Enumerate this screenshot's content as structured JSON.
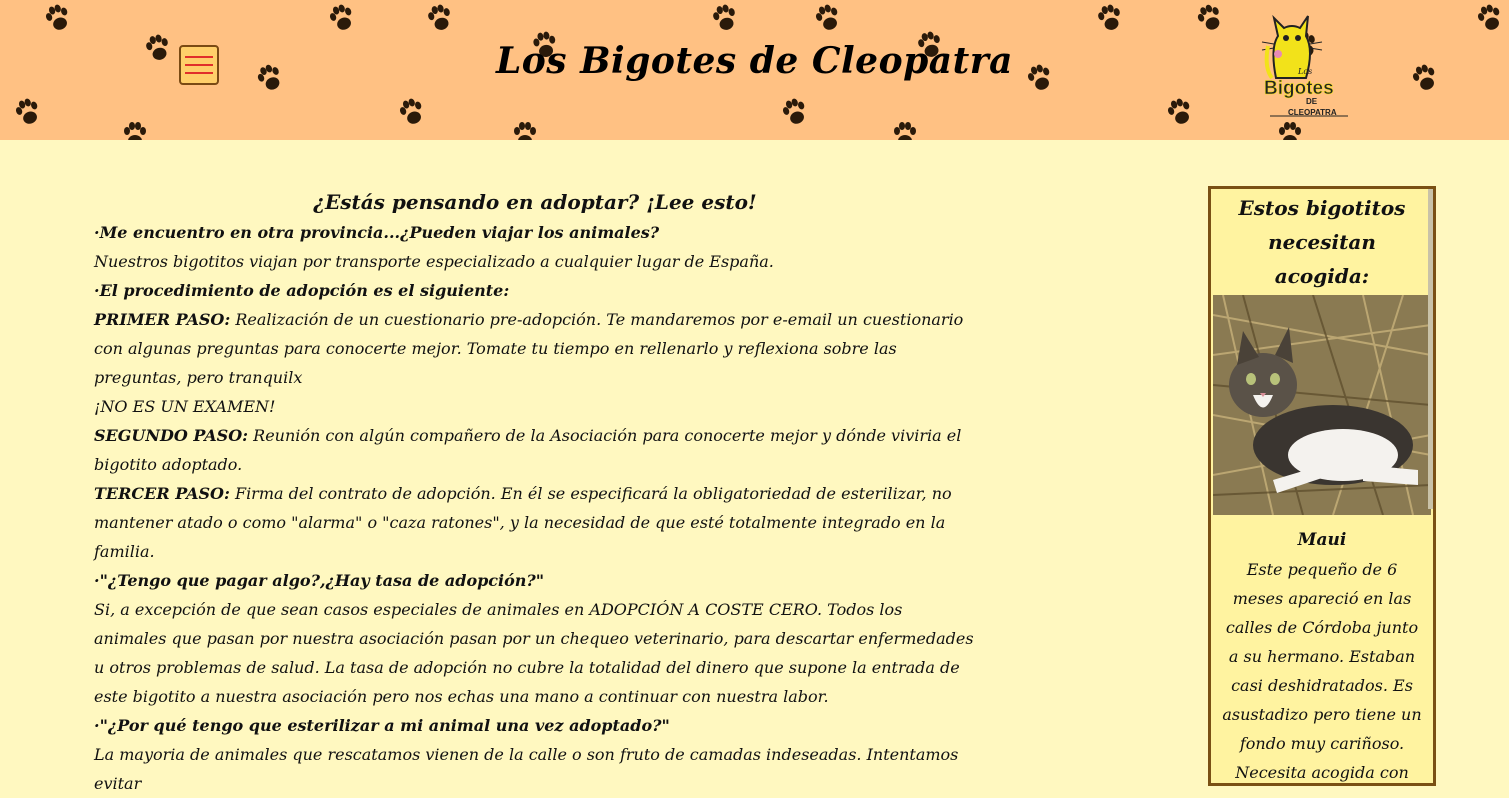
{
  "header": {
    "site_title": "Los Bigotes de Cleopatra",
    "menu_icon": "hamburger-menu-icon",
    "logo": {
      "small_text": "Los",
      "main_text": "Bigotes",
      "de_text": "DE",
      "sub_text": "CLEOPATRA"
    },
    "colors": {
      "header_bg": "#ffc183",
      "page_bg": "#fff8c0",
      "accent_red": "#e0302a"
    }
  },
  "main": {
    "heading": "¿Estás pensando en adoptar? ¡Lee esto!",
    "q1": "·Me encuentro en otra provincia...¿Pueden viajar los animales?",
    "a1": "Nuestros bigotitos viajan por transporte especializado a cualquier lugar de España.",
    "q2": "·El procedimiento de adopción es el siguiente:",
    "step1_label": "PRIMER PASO:",
    "step1_text": " Realización de un cuestionario pre-adopción. Te mandaremos por e-email un cuestionario con algunas preguntas para conocerte mejor. Tomate tu tiempo en rellenarlo y reflexiona sobre las preguntas, pero tranquilx",
    "step1_note": "¡NO ES UN EXAMEN!",
    "step2_label": "SEGUNDO PASO:",
    "step2_text": " Reunión con algún compañero de la Asociación para conocerte mejor y dónde viviria el bigotito adoptado.",
    "step3_label": "TERCER PASO:",
    "step3_text": " Firma del contrato de adopción. En él se especificará la obligatoriedad de esterilizar, no mantener atado o como \"alarma\" o \"caza ratones\", y la necesidad de que esté totalmente integrado en la familia.",
    "q3": "·\"¿Tengo que pagar algo?,¿Hay tasa de adopción?\"",
    "a3_part1": "Si, a excepción de que sean casos especiales de animales en ",
    "a3_highlight": "ADOPCIÓN A COSTE CERO",
    "a3_part2": ". Todos los animales que pasan por nuestra asociación pasan por un chequeo veterinario, para descartar enfermedades u otros problemas de salud. La tasa de adopción no cubre la totalidad del dinero que supone la entrada de este bigotito a nuestra asociación pero nos echas una mano a continuar con nuestra labor.",
    "q4": "·\"¿Por qué tengo que esterilizar a mi animal una vez adoptado?\"",
    "a4": "La mayoria de animales que rescatamos vienen de la calle o son fruto de camadas indeseadas. Intentamos evitar"
  },
  "aside": {
    "title": "Estos bigotitos necesitan acogida:",
    "cat_name": "Maui",
    "cat_description": "Este pequeño de 6 meses apareció en las calles de Córdoba junto a su hermano. Estaban casi deshidratados. Es asustadizo pero tiene un fondo muy cariñoso. Necesita acogida con"
  }
}
